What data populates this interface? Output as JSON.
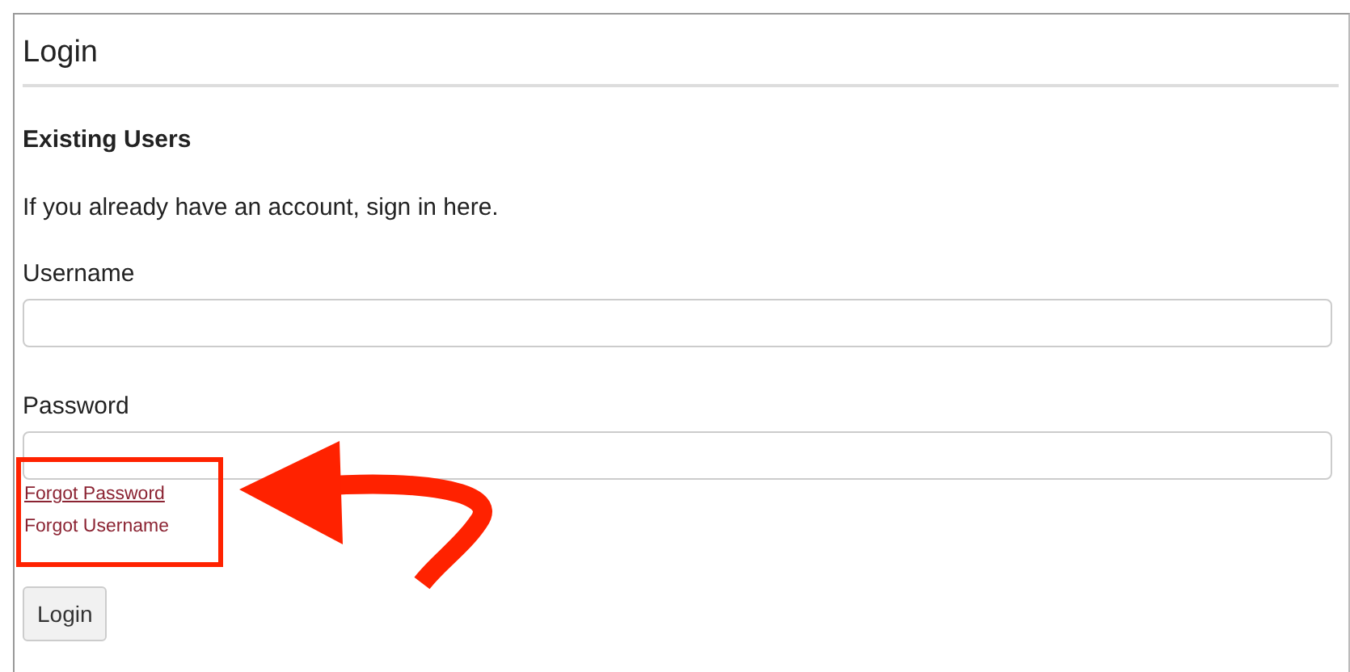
{
  "panel": {
    "title": "Login"
  },
  "section": {
    "heading": "Existing Users",
    "intro": "If you already have an account, sign in here."
  },
  "fields": [
    {
      "label": "Username"
    },
    {
      "label": "Password"
    }
  ],
  "links": [
    {
      "label": "Forgot Password",
      "underlined": true
    },
    {
      "label": "Forgot Username",
      "underlined": false
    }
  ],
  "button": {
    "label": "Login"
  }
}
